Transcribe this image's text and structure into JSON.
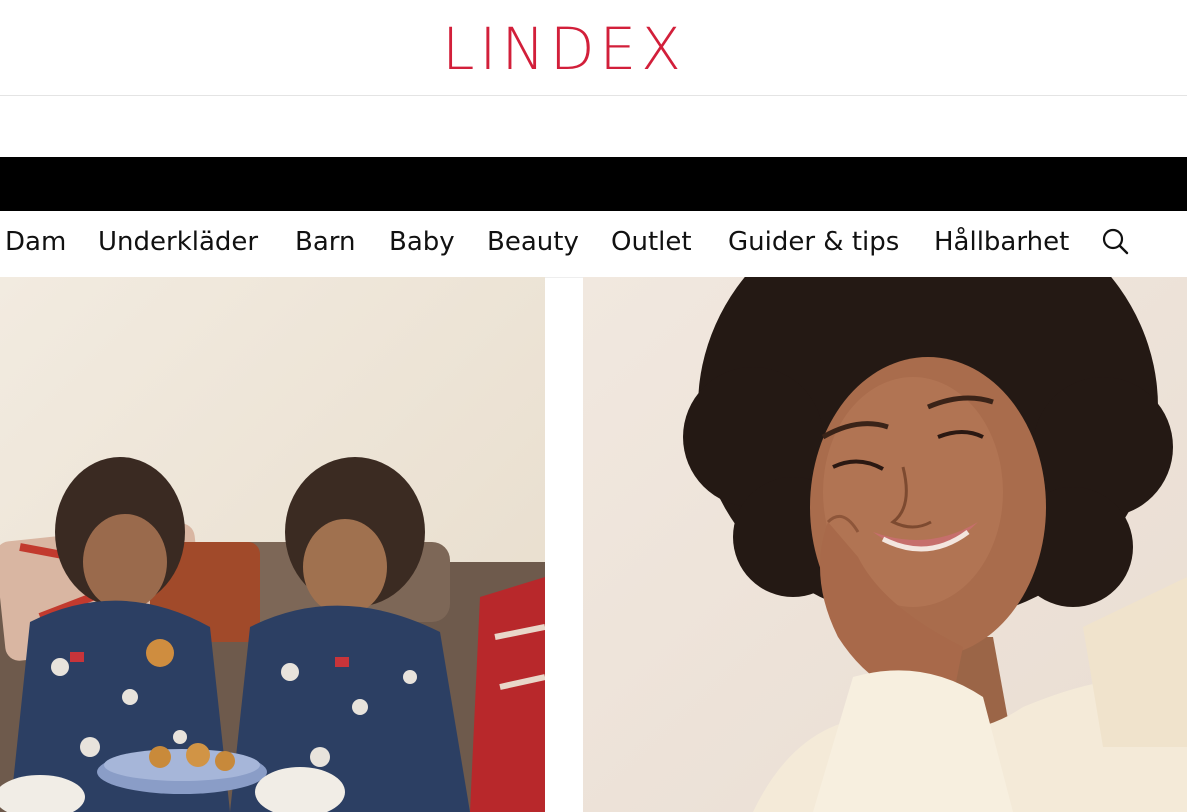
{
  "brand": {
    "logo_text": "LINDEX",
    "accent": "#d21f3a"
  },
  "promo": {
    "background": "#000000"
  },
  "nav": {
    "items": [
      {
        "label": "Dam"
      },
      {
        "label": "Underkläder"
      },
      {
        "label": "Barn"
      },
      {
        "label": "Baby"
      },
      {
        "label": "Beauty"
      },
      {
        "label": "Outlet"
      },
      {
        "label": "Guider & tips"
      },
      {
        "label": "Hållbarhet"
      }
    ],
    "search_icon": "search-icon"
  },
  "hero": {
    "left": {
      "image": "children-in-matching-pajamas-on-sofa"
    },
    "right": {
      "image": "woman-smiling-eyes-closed-hand-on-cheek"
    }
  }
}
